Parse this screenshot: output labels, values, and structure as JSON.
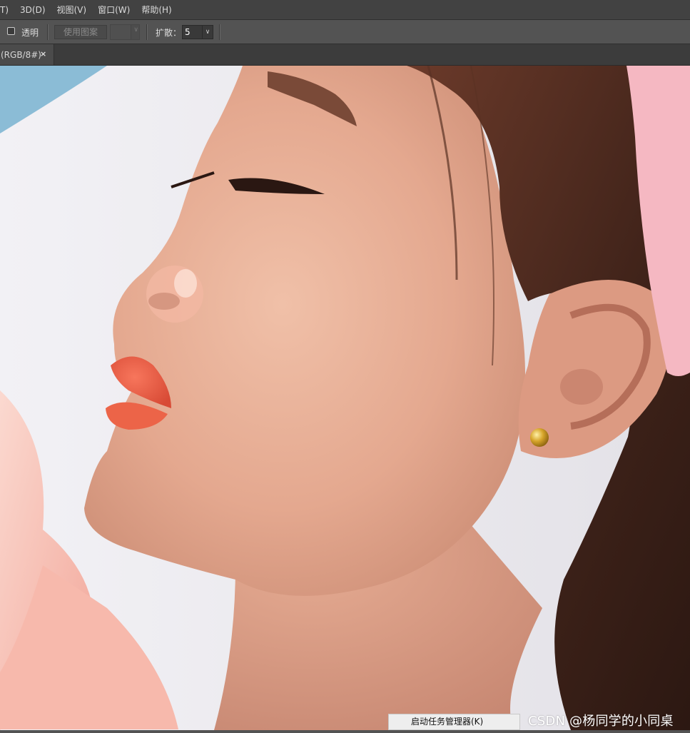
{
  "menubar": {
    "items": [
      "T)",
      "3D(D)",
      "视图(V)",
      "窗口(W)",
      "帮助(H)"
    ]
  },
  "options": {
    "transparent_label": "透明",
    "transparent_checked": false,
    "use_pattern_label": "使用图案",
    "spread_label": "扩散：",
    "spread_value": "5"
  },
  "document": {
    "tab_label": "(RGB/8#)",
    "close_glyph": "×"
  },
  "overlay": {
    "context_menu_item": "启动任务管理器(K)",
    "watermark": "CSDN @杨同学的小同桌"
  },
  "icons": {
    "checkbox": "checkbox-icon",
    "dropdown": "chevron-down-icon",
    "close": "close-icon"
  },
  "colors": {
    "menubar_bg": "#424242",
    "toolbar_bg": "#535353",
    "tab_bg": "#4b4b4b",
    "skin": "#e4a88f",
    "hair": "#4a2a1f",
    "lips": "#e85a45"
  }
}
